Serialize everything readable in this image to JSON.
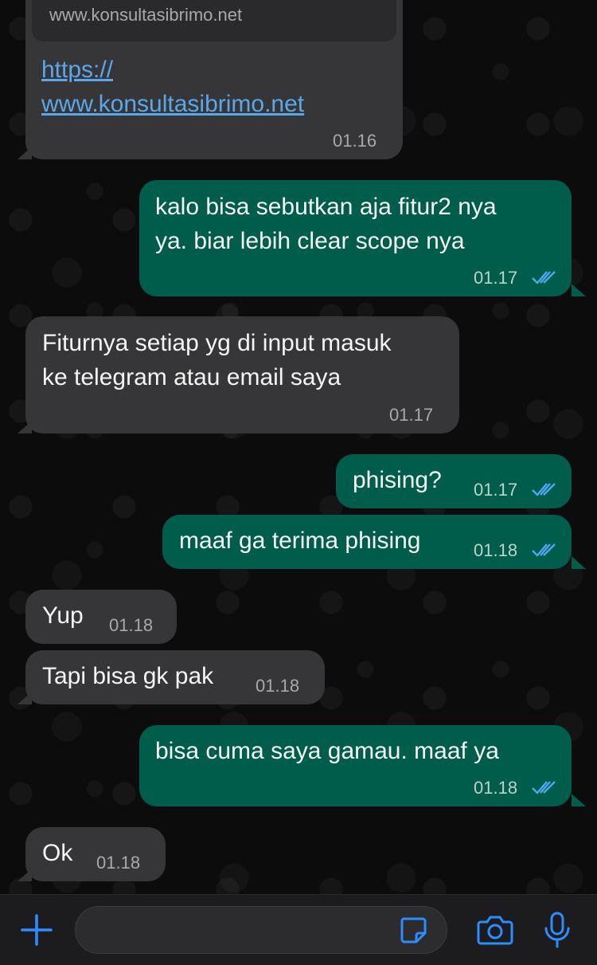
{
  "chat": {
    "link_preview_domain": "www.konsultasibrimo.net",
    "link_line1": "https://",
    "link_line2": "www.konsultasibrimo.net",
    "messages": [
      {
        "dir": "in",
        "lines": [],
        "time": "01.16"
      },
      {
        "dir": "out",
        "lines": [
          "kalo bisa sebutkan aja fitur2 nya",
          "ya. biar lebih clear scope nya"
        ],
        "time": "01.17",
        "status": "read"
      },
      {
        "dir": "in",
        "lines": [
          "Fiturnya setiap yg di input masuk",
          "ke telegram atau email saya"
        ],
        "time": "01.17"
      },
      {
        "dir": "out",
        "lines": [
          "phising?"
        ],
        "time": "01.17",
        "status": "read"
      },
      {
        "dir": "out",
        "lines": [
          "maaf ga terima phising"
        ],
        "time": "01.18",
        "status": "read"
      },
      {
        "dir": "in",
        "lines": [
          "Yup"
        ],
        "time": "01.18"
      },
      {
        "dir": "in",
        "lines": [
          "Tapi bisa gk pak"
        ],
        "time": "01.18"
      },
      {
        "dir": "out",
        "lines": [
          "bisa cuma saya gamau. maaf ya"
        ],
        "time": "01.18",
        "status": "read"
      },
      {
        "dir": "in",
        "lines": [
          "Ok"
        ],
        "time": "01.18"
      }
    ]
  },
  "composer": {
    "placeholder": "",
    "icons": [
      "plus-icon",
      "sticker-icon",
      "camera-icon",
      "microphone-icon"
    ]
  },
  "colors": {
    "incoming_bubble": "#363638",
    "outgoing_bubble": "#005c4b",
    "link": "#5aa7ea",
    "read_ticks": "#4fa7f0",
    "accent": "#2d8cff"
  }
}
